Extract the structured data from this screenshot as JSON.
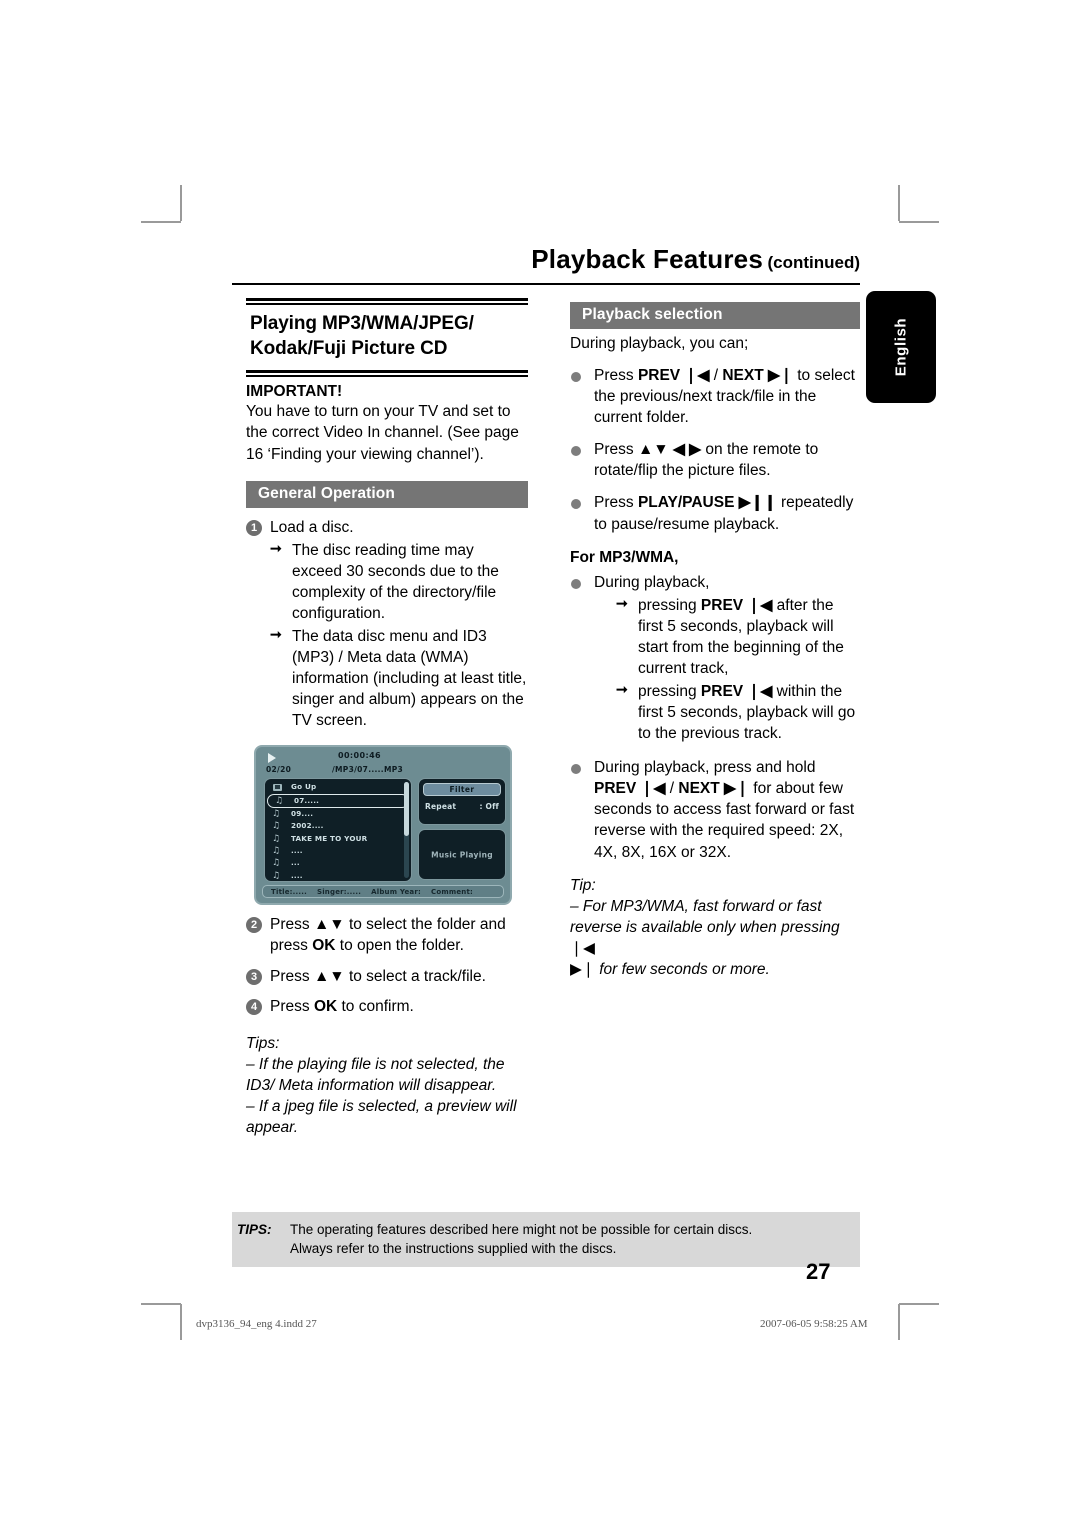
{
  "header": {
    "title": "Playback Features",
    "continued": "(continued)"
  },
  "language_tab": {
    "label": "English"
  },
  "left_column": {
    "section_title": "Playing MP3/WMA/JPEG/ Kodak/Fuji Picture CD",
    "section_title_line1": "Playing MP3/WMA/JPEG/",
    "section_title_line2": "Kodak/Fuji Picture CD",
    "important_heading": "IMPORTANT!",
    "important_body": "You have to turn on your TV and set to the correct Video In channel.  (See page 16 ‘Finding your viewing channel’).",
    "general_operation_heading": "General Operation",
    "step1_text": "Load a disc.",
    "step1_num": "1",
    "step1_arrow1": "The disc reading time may exceed 30 seconds due to the complexity of the directory/file configuration.",
    "step1_arrow2": "The data disc menu and ID3 (MP3) / Meta data (WMA) information (including at least title, singer and album) appears on the TV screen.",
    "step2_num": "2",
    "step2_pre": "Press",
    "step2_arrows": "▲▼",
    "step2_mid": "to select the folder and press",
    "step2_bold": "OK",
    "step2_post": "to open the folder.",
    "step3_num": "3",
    "step3_pre": "Press",
    "step3_arrows": "▲▼",
    "step3_post": "to select a track/file.",
    "step4_num": "4",
    "step4_pre": "Press",
    "step4_bold": "OK",
    "step4_post": "to confirm.",
    "tips_heading": "Tips:",
    "tip1": "– If the playing file is not selected, the ID3/ Meta information will disappear.",
    "tip2": "– If a jpeg file is selected, a preview will appear."
  },
  "tv_screen": {
    "play_icon": "play-icon",
    "time": "00:00:46",
    "track_counter": "02/20",
    "path": "/MP3/07.....MP3",
    "list": [
      {
        "icon": "folder-icon",
        "label": "Go Up",
        "selected": false
      },
      {
        "icon": "music-note-icon",
        "label": "07.....",
        "selected": true
      },
      {
        "icon": "music-note-icon",
        "label": "09....",
        "selected": false
      },
      {
        "icon": "music-note-icon",
        "label": "2002....",
        "selected": false
      },
      {
        "icon": "music-note-icon",
        "label": "TAKE ME TO YOUR",
        "selected": false
      },
      {
        "icon": "music-note-icon",
        "label": "....",
        "selected": false
      },
      {
        "icon": "music-note-icon",
        "label": "...",
        "selected": false
      },
      {
        "icon": "music-note-icon",
        "label": "....",
        "selected": false
      }
    ],
    "filter_label": "Filter",
    "repeat_label": "Repeat",
    "repeat_value": ": Off",
    "music_playing": "Music Playing",
    "status_title": "Title:.....",
    "status_singer": "Singer:.....",
    "status_album": "Album Year:",
    "status_comment": "Comment:"
  },
  "right_column": {
    "playback_selection_heading": "Playback selection",
    "intro": "During playback, you can;",
    "b1_pre": "Press",
    "b1_prev": "PREV",
    "b1_prev_icon": "❘◀",
    "b1_sep": "/",
    "b1_next": "NEXT",
    "b1_next_icon": "▶❘",
    "b1_post": "to select the previous/next track/file in the current folder.",
    "b2_pre": "Press",
    "b2_arrows_ud": "▲▼",
    "b2_arrows_lr": "◀ ▶",
    "b2_post": "on the remote to rotate/flip the picture files.",
    "b3_pre": "Press",
    "b3_bold": "PLAY/PAUSE",
    "b3_icon": "▶❙❙",
    "b3_post": "repeatedly to pause/resume playback.",
    "formp3_heading": "For MP3/WMA,",
    "b4_text": "During playback,",
    "b4_arrow1_pre": "pressing",
    "b4_arrow1_bold": "PREV",
    "b4_arrow1_icon": "❘◀",
    "b4_arrow1_post": "after the first 5 seconds, playback will start from the beginning of the current track,",
    "b4_arrow2_pre": "pressing",
    "b4_arrow2_bold": "PREV",
    "b4_arrow2_icon": "❘◀",
    "b4_arrow2_post": "within the first 5 seconds, playback will go to the previous track.",
    "b5_line1": "During playback, press and hold",
    "b5_prev": "PREV",
    "b5_prev_icon": "❘◀",
    "b5_sep": "/",
    "b5_next": "NEXT",
    "b5_next_icon": "▶❘",
    "b5_post": "for about few seconds to access fast forward or fast reverse with the required speed: 2X, 4X, 8X, 16X or 32X.",
    "tip_heading": "Tip:",
    "tip_line1": "– For MP3/WMA, fast forward or fast reverse is available only when pressing",
    "tip_icon1": "❘◀",
    "tip_icon2": "▶❘",
    "tip_line2": "for few seconds or more."
  },
  "footer": {
    "tips_label": "TIPS:",
    "tips_line1": "The operating features described here might not be possible for certain discs.",
    "tips_line2": "Always refer to the instructions supplied with the discs.",
    "page_number": "27",
    "print_file": "dvp3136_94_eng 4.indd   27",
    "print_date": "2007-06-05   9:58:25 AM"
  },
  "colors": {
    "bar_heading_bg": "#757575",
    "footer_tips_bg": "#d8d8d8",
    "tv_bg": "#6d8c92",
    "tv_panel_bg": "#0f1f26",
    "tab_bg": "#000000"
  }
}
